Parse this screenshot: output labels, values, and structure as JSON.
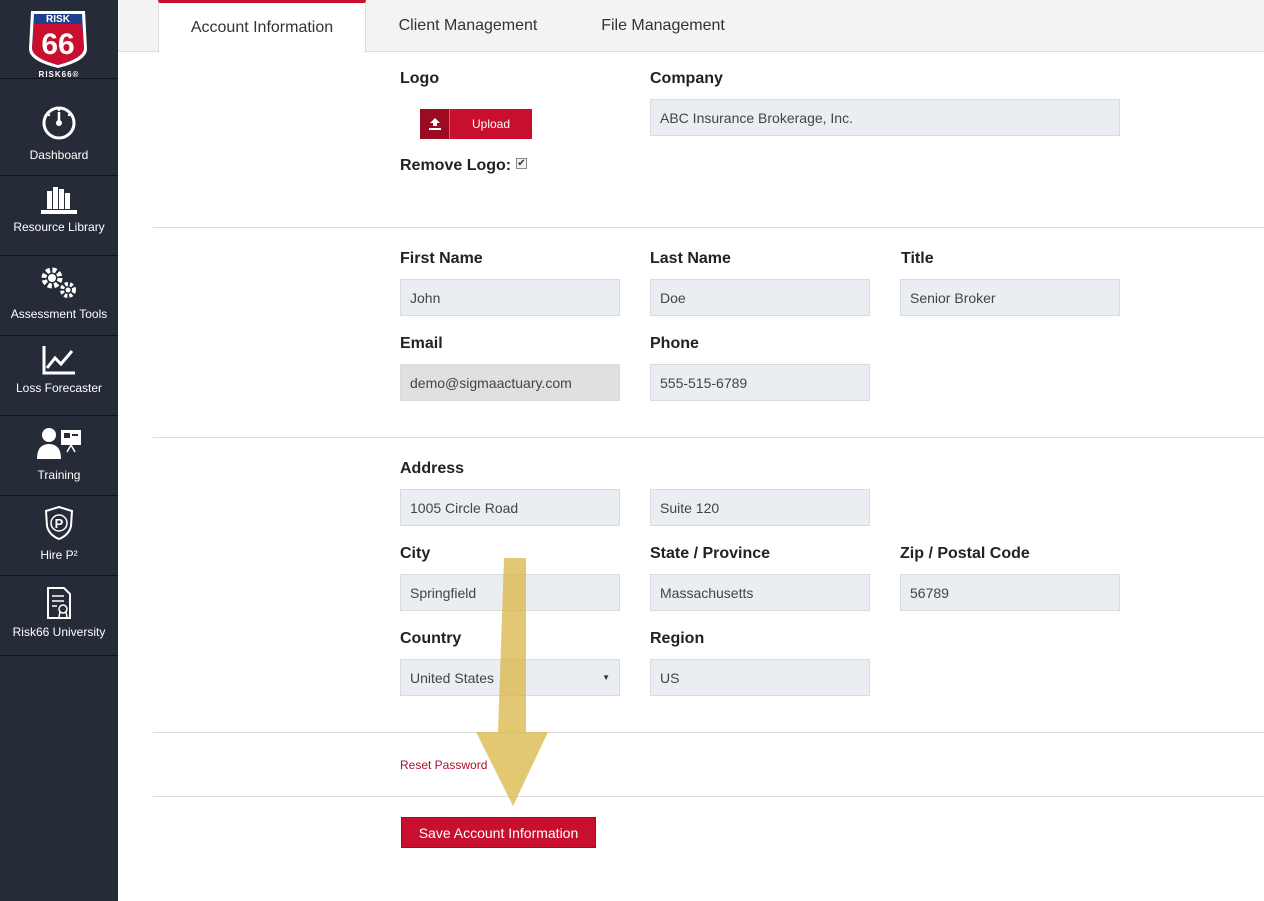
{
  "sidebar": {
    "logo_text": "RISK",
    "logo_number": "66",
    "logo_sub": "RISK66®",
    "items": [
      {
        "label": "Dashboard",
        "icon": "dashboard-icon"
      },
      {
        "label": "Resource Library",
        "icon": "library-icon"
      },
      {
        "label": "Assessment Tools",
        "icon": "gears-icon"
      },
      {
        "label": "Loss Forecaster",
        "icon": "chart-line-icon"
      },
      {
        "label": "Training",
        "icon": "training-icon"
      },
      {
        "label": "Hire P²",
        "icon": "shield-p-icon"
      },
      {
        "label": "Risk66 University",
        "icon": "certificate-icon"
      }
    ]
  },
  "tabs": [
    {
      "label": "Account Information",
      "active": true
    },
    {
      "label": "Client Management",
      "active": false
    },
    {
      "label": "File Management",
      "active": false
    }
  ],
  "form": {
    "logo_label": "Logo",
    "upload_label": "Upload",
    "remove_logo_label": "Remove Logo:",
    "remove_logo_checked": true,
    "company_label": "Company",
    "company_value": "ABC Insurance Brokerage, Inc.",
    "first_name_label": "First Name",
    "first_name_value": "John",
    "last_name_label": "Last Name",
    "last_name_value": "Doe",
    "title_label": "Title",
    "title_value": "Senior Broker",
    "email_label": "Email",
    "email_value": "demo@sigmaactuary.com",
    "phone_label": "Phone",
    "phone_value": "555-515-6789",
    "address_label": "Address",
    "address_line1": "1005 Circle Road",
    "address_line2": "Suite 120",
    "city_label": "City",
    "city_value": "Springfield",
    "state_label": "State / Province",
    "state_value": "Massachusetts",
    "zip_label": "Zip / Postal Code",
    "zip_value": "56789",
    "country_label": "Country",
    "country_value": "United States",
    "region_label": "Region",
    "region_value": "US",
    "reset_password_label": "Reset Password",
    "save_label": "Save Account Information"
  },
  "colors": {
    "sidebar_bg": "#262b38",
    "accent": "#c8102e",
    "input_bg": "#eaedf1",
    "annotation_arrow": "#e0c25a"
  }
}
